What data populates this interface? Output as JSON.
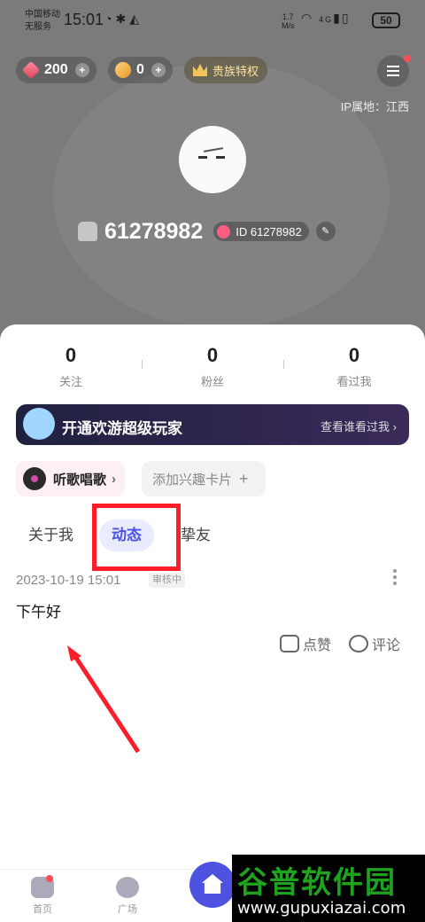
{
  "status_bar": {
    "carrier_line1": "中国移动",
    "carrier_line2": "无服务",
    "time": "15:01",
    "net_speed_value": "1.7",
    "net_speed_unit": "M/s",
    "signal_label": "4G",
    "battery": "50"
  },
  "header": {
    "diamond_count": "200",
    "bean_count": "0",
    "plus": "+",
    "noble_label": "贵族特权",
    "ip_location": "IP属地：江西",
    "nickname": "61278982",
    "id_badge": "ID 61278982"
  },
  "stats": [
    {
      "value": "0",
      "label": "关注"
    },
    {
      "value": "0",
      "label": "粉丝"
    },
    {
      "value": "0",
      "label": "看过我"
    }
  ],
  "vip_banner": {
    "title": "开通欢游超级玩家",
    "link": "查看谁看过我 ›"
  },
  "interest_tags": {
    "song_label": "听歌唱歌",
    "song_chevron": "›",
    "add_label": "添加兴趣卡片",
    "add_plus": "+"
  },
  "tabs": [
    {
      "label": "关于我",
      "active": false
    },
    {
      "label": "动态",
      "active": true
    },
    {
      "label": "挚友",
      "active": false
    }
  ],
  "post": {
    "date": "2023-10-19  15:01",
    "status_badge": "审核中",
    "text": "下午好",
    "like_label": "点赞",
    "comment_label": "评论"
  },
  "bottom_nav": [
    {
      "label": "首页",
      "icon": "gamepad-icon"
    },
    {
      "label": "广场",
      "icon": "planet-icon"
    }
  ],
  "watermark": {
    "title": "谷普软件园",
    "url": "www.gupuxiazai.com"
  },
  "colors": {
    "accent": "#4d53e0",
    "annotation_red": "#ff1d2a",
    "vip_bg": "#20213f"
  }
}
